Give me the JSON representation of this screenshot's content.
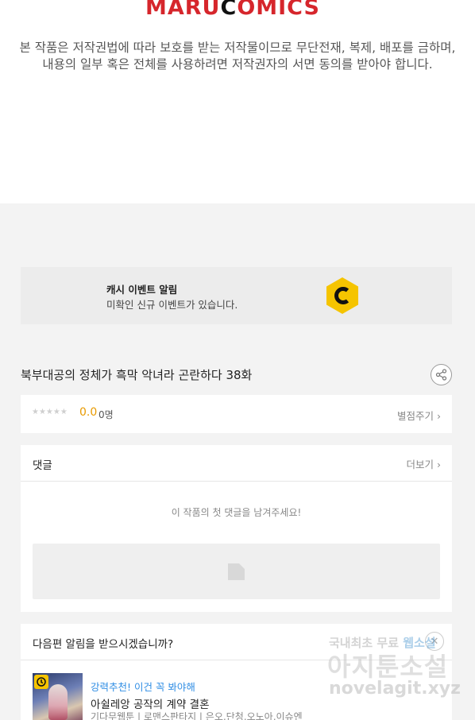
{
  "header": {
    "logo_left": "MARU ",
    "logo_c": "C",
    "logo_right": "OMICS",
    "copyright_line1": "본 작품은 저작권법에 따라 보호를 받는 저작물이므로 무단전재, 복제, 배포를 금하며,",
    "copyright_line2": "내용의 일부 혹은 전체를 사용하려면 저작권자의 서면 동의를 받아야 합니다."
  },
  "event": {
    "title": "캐시 이벤트 알림",
    "subtitle": "미확인 신규 이벤트가 있습니다.",
    "icon": "cash-c-icon",
    "icon_color": "#f5c400"
  },
  "episode": {
    "title": "북부대공의 정체가 흑막 악녀라 곤란하다 38화",
    "share_icon": "share-icon"
  },
  "rating": {
    "stars": "★★★★★",
    "stars_filled": 0,
    "score": "0.0",
    "count": "0명",
    "rate_link": "별점주기 ›",
    "score_color": "#e89a00"
  },
  "comments": {
    "label": "댓글",
    "more": "더보기 ›",
    "empty_message": "이 작품의 첫 댓글을 남겨주세요!",
    "input_icon": "write-icon"
  },
  "next_alert": {
    "label": "다음편 알림을 받으시겠습니까?",
    "close": "✕"
  },
  "recommendation": {
    "tag": "강력추천! 이건 꼭 봐야해",
    "title": "아쉴레앙 공작의 계약 결혼",
    "genre": "기다무웹툰 | 로맨스판타지 | 은오,단청,오노아,이슈엔",
    "badge_icon": "clock-icon",
    "tag_color": "#2f8de4"
  },
  "watermark": {
    "line1_a": "국내최초 무료 ",
    "line1_b": "웹소설",
    "line2": "아지툰소설",
    "line3": "novelagit.xyz"
  }
}
